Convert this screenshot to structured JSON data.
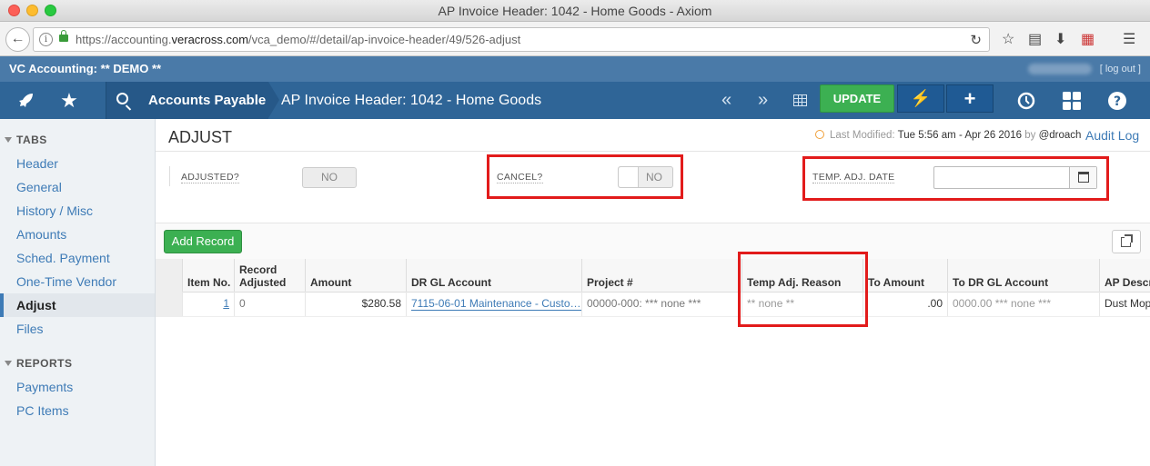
{
  "window": {
    "title": "AP Invoice Header: 1042 - Home Goods - Axiom"
  },
  "browser": {
    "url_prefix": "https://accounting.",
    "url_domain": "veracross.com",
    "url_path": "/vca_demo/#/detail/ap-invoice-header/49/526-adjust"
  },
  "app": {
    "title": "VC Accounting: ** DEMO **",
    "logout": "[ log out ]",
    "breadcrumb_module": "Accounts Payable",
    "breadcrumb_page": "AP Invoice Header: 1042 - Home Goods",
    "prev": "«",
    "next": "»",
    "update_label": "UPDATE",
    "plus_label": "+"
  },
  "sidebar": {
    "tabs_heading": "TABS",
    "tabs": [
      "Header",
      "General",
      "History / Misc",
      "Amounts",
      "Sched. Payment",
      "One-Time Vendor",
      "Adjust",
      "Files"
    ],
    "active_tab": "Adjust",
    "reports_heading": "REPORTS",
    "reports": [
      "Payments",
      "PC Items"
    ]
  },
  "main": {
    "title": "ADJUST",
    "last_modified_label": "Last Modified:",
    "last_modified_value": "Tue 5:56 am - Apr 26 2016",
    "by_label": "by",
    "by_user": "@droach",
    "audit_log": "Audit Log",
    "fields": {
      "adjusted_label": "ADJUSTED?",
      "adjusted_value": "NO",
      "cancel_label": "CANCEL?",
      "cancel_value": "NO",
      "temp_adj_date_label": "TEMP. ADJ. DATE",
      "temp_adj_date_value": ""
    },
    "add_record": "Add Record"
  },
  "table": {
    "columns": [
      "Item No.",
      "Record Adjusted",
      "Amount",
      "DR GL Account",
      "Project #",
      "Temp Adj. Reason",
      "To Amount",
      "To DR GL Account",
      "AP Descr"
    ],
    "rows": [
      {
        "item_no": "1",
        "record_adjusted": "0",
        "amount": "$280.58",
        "dr_gl_account": "7115-06-01 Maintenance - Custo…",
        "project": "00000-000: *** none ***",
        "temp_adj_reason": "** none **",
        "to_amount": ".00",
        "to_dr_gl_account": "0000.00 *** none ***",
        "ap_descr": "Dust Mop"
      }
    ]
  },
  "colors": {
    "accent": "#2f6597",
    "success": "#3cb052",
    "highlight": "#e21b1b",
    "link": "#3e7bb6"
  }
}
